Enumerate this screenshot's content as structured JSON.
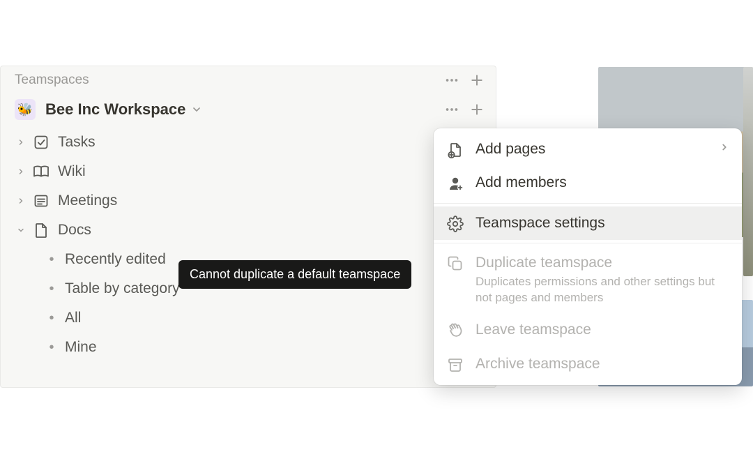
{
  "sidebar": {
    "section_label": "Teamspaces",
    "workspace": {
      "name": "Bee Inc Workspace",
      "emoji": "🐝"
    },
    "pages": [
      {
        "label": "Tasks",
        "icon": "checkbox"
      },
      {
        "label": "Wiki",
        "icon": "book"
      },
      {
        "label": "Meetings",
        "icon": "list"
      },
      {
        "label": "Docs",
        "icon": "page",
        "expanded": true,
        "children": [
          {
            "label": "Recently edited"
          },
          {
            "label": "Table by category"
          },
          {
            "label": "All"
          },
          {
            "label": "Mine"
          }
        ]
      }
    ]
  },
  "tooltip": {
    "text": "Cannot duplicate a default teamspace"
  },
  "menu": {
    "items": [
      {
        "key": "add-pages",
        "label": "Add pages",
        "has_submenu": true
      },
      {
        "key": "add-members",
        "label": "Add members"
      },
      {
        "key": "settings",
        "label": "Teamspace settings",
        "highlighted": true
      },
      {
        "key": "duplicate",
        "label": "Duplicate teamspace",
        "sub": "Duplicates permissions and other settings but not pages and members",
        "disabled": true
      },
      {
        "key": "leave",
        "label": "Leave teamspace",
        "disabled": true
      },
      {
        "key": "archive",
        "label": "Archive teamspace",
        "disabled": true
      }
    ]
  }
}
